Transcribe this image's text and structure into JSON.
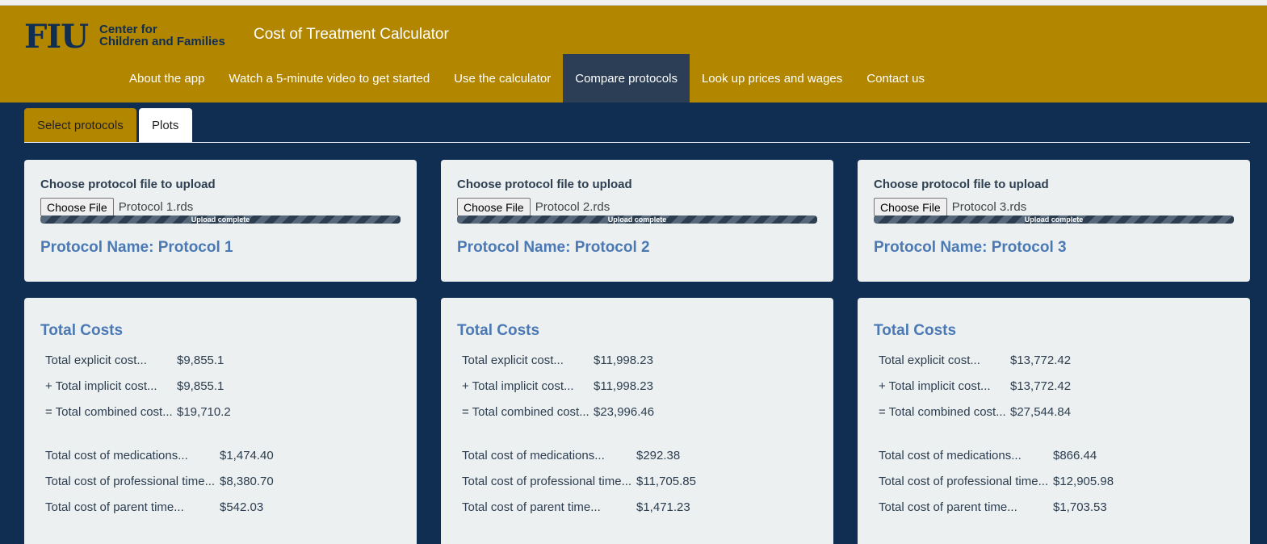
{
  "header": {
    "logo_mark": "FIU",
    "logo_line1": "Center for",
    "logo_line2": "Children and Families",
    "app_title": "Cost of Treatment Calculator"
  },
  "nav": {
    "items": [
      {
        "label": "About the app"
      },
      {
        "label": "Watch a 5-minute video to get started"
      },
      {
        "label": "Use the calculator"
      },
      {
        "label": "Compare protocols",
        "active": true
      },
      {
        "label": "Look up prices and wages"
      },
      {
        "label": "Contact us"
      }
    ]
  },
  "tabs": {
    "select": "Select protocols",
    "plots": "Plots"
  },
  "colors": {
    "navy": "#0f2e52",
    "gold": "#b38600",
    "link_blue": "#4b79b4"
  },
  "protocols": [
    {
      "upload_label": "Choose protocol file to upload",
      "choose_button": "Choose File",
      "file_name": "Protocol 1.rds",
      "progress_text": "Upload complete",
      "progress": 1.0,
      "name": "Protocol Name: Protocol 1",
      "costs_title": "Total Costs",
      "explicit_label": "Total explicit cost...",
      "explicit": "$9,855.1",
      "implicit_label": "+ Total implicit cost...",
      "implicit": "$9,855.1",
      "combined_label": "= Total combined cost...",
      "combined": "$19,710.2",
      "meds_label": "Total cost of medications...",
      "meds": "$1,474.40",
      "prof_label": "Total cost of professional time...",
      "prof": "$8,380.70",
      "parent_label": "Total cost of parent time...",
      "parent": "$542.03"
    },
    {
      "upload_label": "Choose protocol file to upload",
      "choose_button": "Choose File",
      "file_name": "Protocol 2.rds",
      "progress_text": "Upload complete",
      "progress": 1.0,
      "name": "Protocol Name: Protocol 2",
      "costs_title": "Total Costs",
      "explicit_label": "Total explicit cost...",
      "explicit": "$11,998.23",
      "implicit_label": "+ Total implicit cost...",
      "implicit": "$11,998.23",
      "combined_label": "= Total combined cost...",
      "combined": "$23,996.46",
      "meds_label": "Total cost of medications...",
      "meds": "$292.38",
      "prof_label": "Total cost of professional time...",
      "prof": "$11,705.85",
      "parent_label": "Total cost of parent time...",
      "parent": "$1,471.23"
    },
    {
      "upload_label": "Choose protocol file to upload",
      "choose_button": "Choose File",
      "file_name": "Protocol 3.rds",
      "progress_text": "Upload complete",
      "progress": 1.0,
      "name": "Protocol Name: Protocol 3",
      "costs_title": "Total Costs",
      "explicit_label": "Total explicit cost...",
      "explicit": "$13,772.42",
      "implicit_label": "+ Total implicit cost...",
      "implicit": "$13,772.42",
      "combined_label": "= Total combined cost...",
      "combined": "$27,544.84",
      "meds_label": "Total cost of medications...",
      "meds": "$866.44",
      "prof_label": "Total cost of professional time...",
      "prof": "$12,905.98",
      "parent_label": "Total cost of parent time...",
      "parent": "$1,703.53"
    }
  ]
}
